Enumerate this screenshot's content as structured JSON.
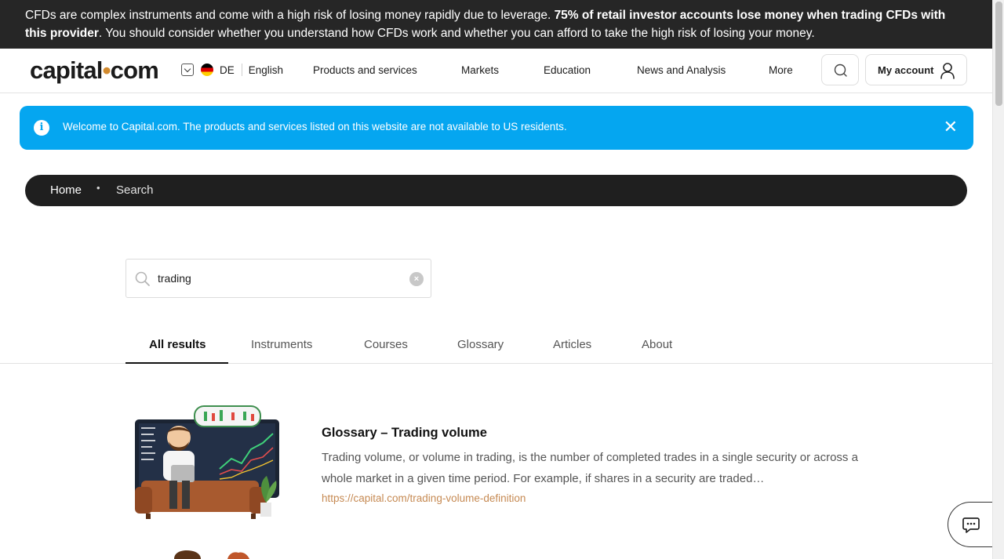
{
  "risk_banner": {
    "text_before": "CFDs are complex instruments and come with a high risk of losing money rapidly due to leverage. ",
    "text_bold": "75% of retail investor accounts lose money when trading CFDs with this provider",
    "text_after": ". You should consider whether you understand how CFDs work and whether you can afford to take the high risk of losing your money."
  },
  "header": {
    "logo": {
      "part1": "capital",
      "dot": "•",
      "part2": "com"
    },
    "country_code": "DE",
    "language": "English",
    "nav": [
      "Products and services",
      "Markets",
      "Education",
      "News and Analysis",
      "More"
    ],
    "account_label": "My account"
  },
  "info_banner": {
    "icon": "i",
    "text": "Welcome to Capital.com. The products and services listed on this website are not available to US residents.",
    "close": "✕"
  },
  "breadcrumb": {
    "home": "Home",
    "dot": "•",
    "current": "Search"
  },
  "search": {
    "value": "trading",
    "clear": "×"
  },
  "tabs": [
    "All results",
    "Instruments",
    "Courses",
    "Glossary",
    "Articles",
    "About"
  ],
  "results": [
    {
      "title": "Glossary – Trading volume",
      "description": "Trading volume, or volume in trading, is the number of completed trades in a single security or across a whole market in a given time period. For example, if shares in a security are traded…",
      "url": "https://capital.com/trading-volume-definition"
    }
  ],
  "icons": {
    "search": "search-icon",
    "account": "person-icon",
    "info": "info-icon",
    "close": "close-icon",
    "chat": "chat-icon",
    "flag": "germany-flag-icon"
  },
  "colors": {
    "risk_bg": "#262626",
    "info_bg": "#05a6f0",
    "breadcrumb_bg": "#1f1f1f",
    "link": "#c68a53",
    "logo_dot": "#d28a2e"
  }
}
